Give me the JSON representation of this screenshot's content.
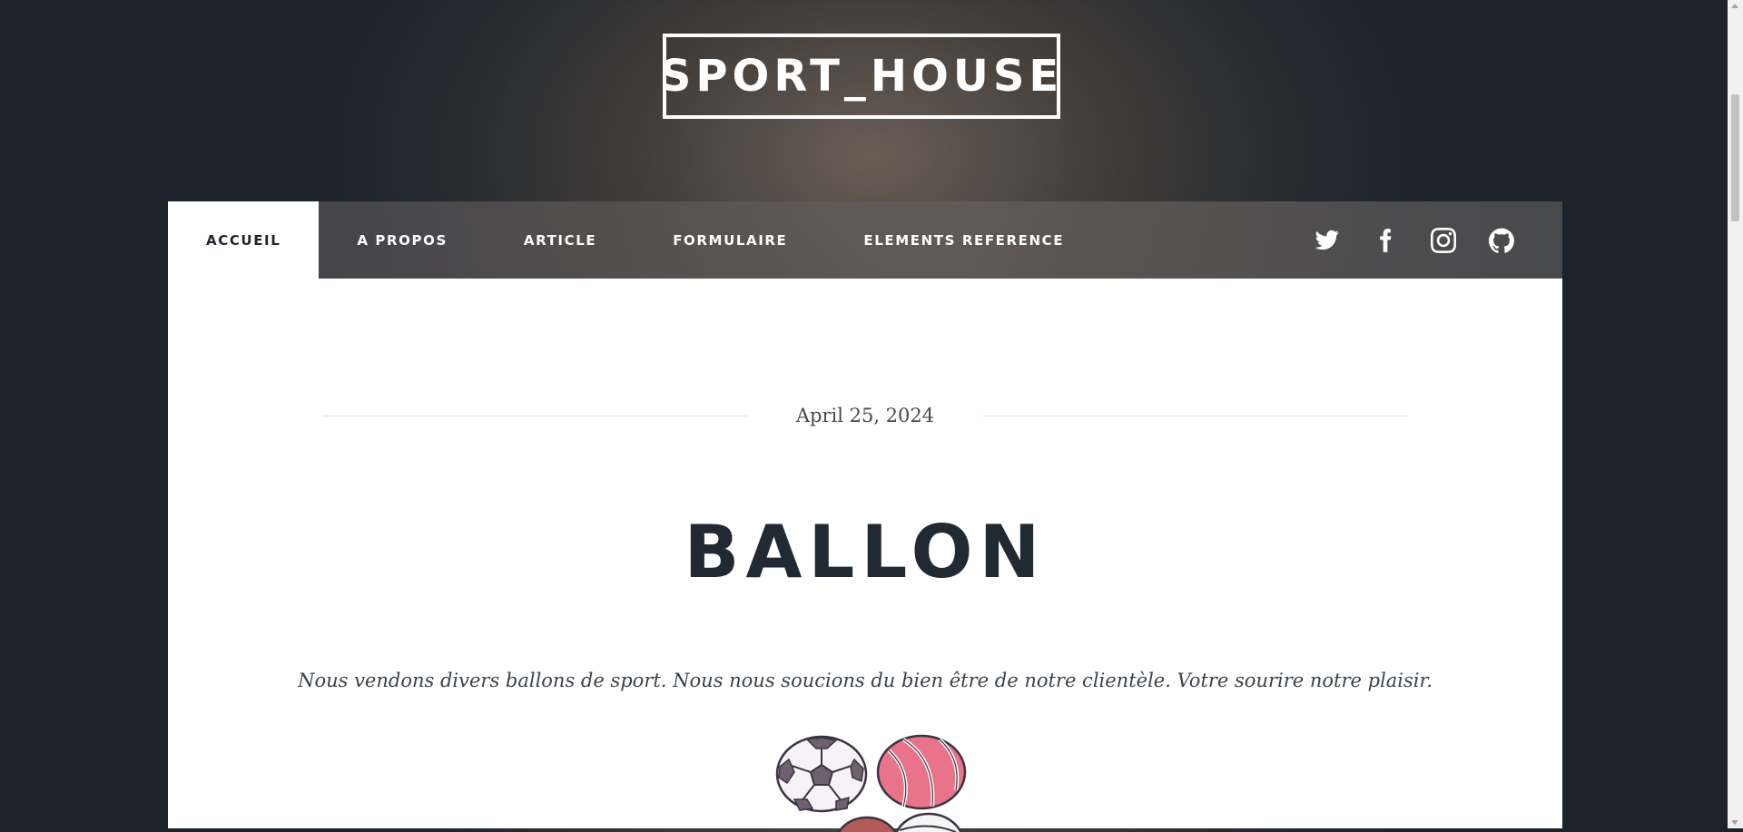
{
  "header": {
    "logo": "SPORT_HOUSE"
  },
  "nav": {
    "items": [
      {
        "label": "ACCUEIL",
        "active": true
      },
      {
        "label": "A PROPOS"
      },
      {
        "label": "ARTICLE"
      },
      {
        "label": "FORMULAIRE"
      },
      {
        "label": "ELEMENTS REFERENCE"
      }
    ],
    "social": [
      "twitter-icon",
      "facebook-icon",
      "instagram-icon",
      "github-icon"
    ]
  },
  "post": {
    "date": "April 25, 2024",
    "title": "BALLON",
    "lead": "Nous vendons divers ballons de sport. Nous nous soucions du bien être de notre clientèle. Votre sourire notre plaisir."
  },
  "colors": {
    "accent_dark": "#212a33",
    "nav_text": "#ffffff",
    "content_bg": "#ffffff"
  }
}
